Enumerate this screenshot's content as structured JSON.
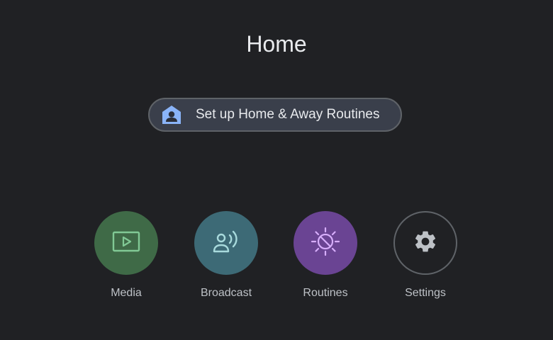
{
  "header": {
    "title": "Home"
  },
  "setup_chip": {
    "label": "Set up Home & Away Routines",
    "icon": "home-person-icon",
    "icon_color": "#8ab4f8"
  },
  "tiles": [
    {
      "label": "Media",
      "icon": "media-play-icon",
      "color": "#3f6a47",
      "icon_color": "#81c995"
    },
    {
      "label": "Broadcast",
      "icon": "broadcast-icon",
      "color": "#3d6a76",
      "icon_color": "#a8dadc"
    },
    {
      "label": "Routines",
      "icon": "routines-sun-icon",
      "color": "#6a4493",
      "icon_color": "#d7aefb"
    },
    {
      "label": "Settings",
      "icon": "gear-icon",
      "color": "#202124",
      "icon_color": "#bdc1c6"
    }
  ]
}
